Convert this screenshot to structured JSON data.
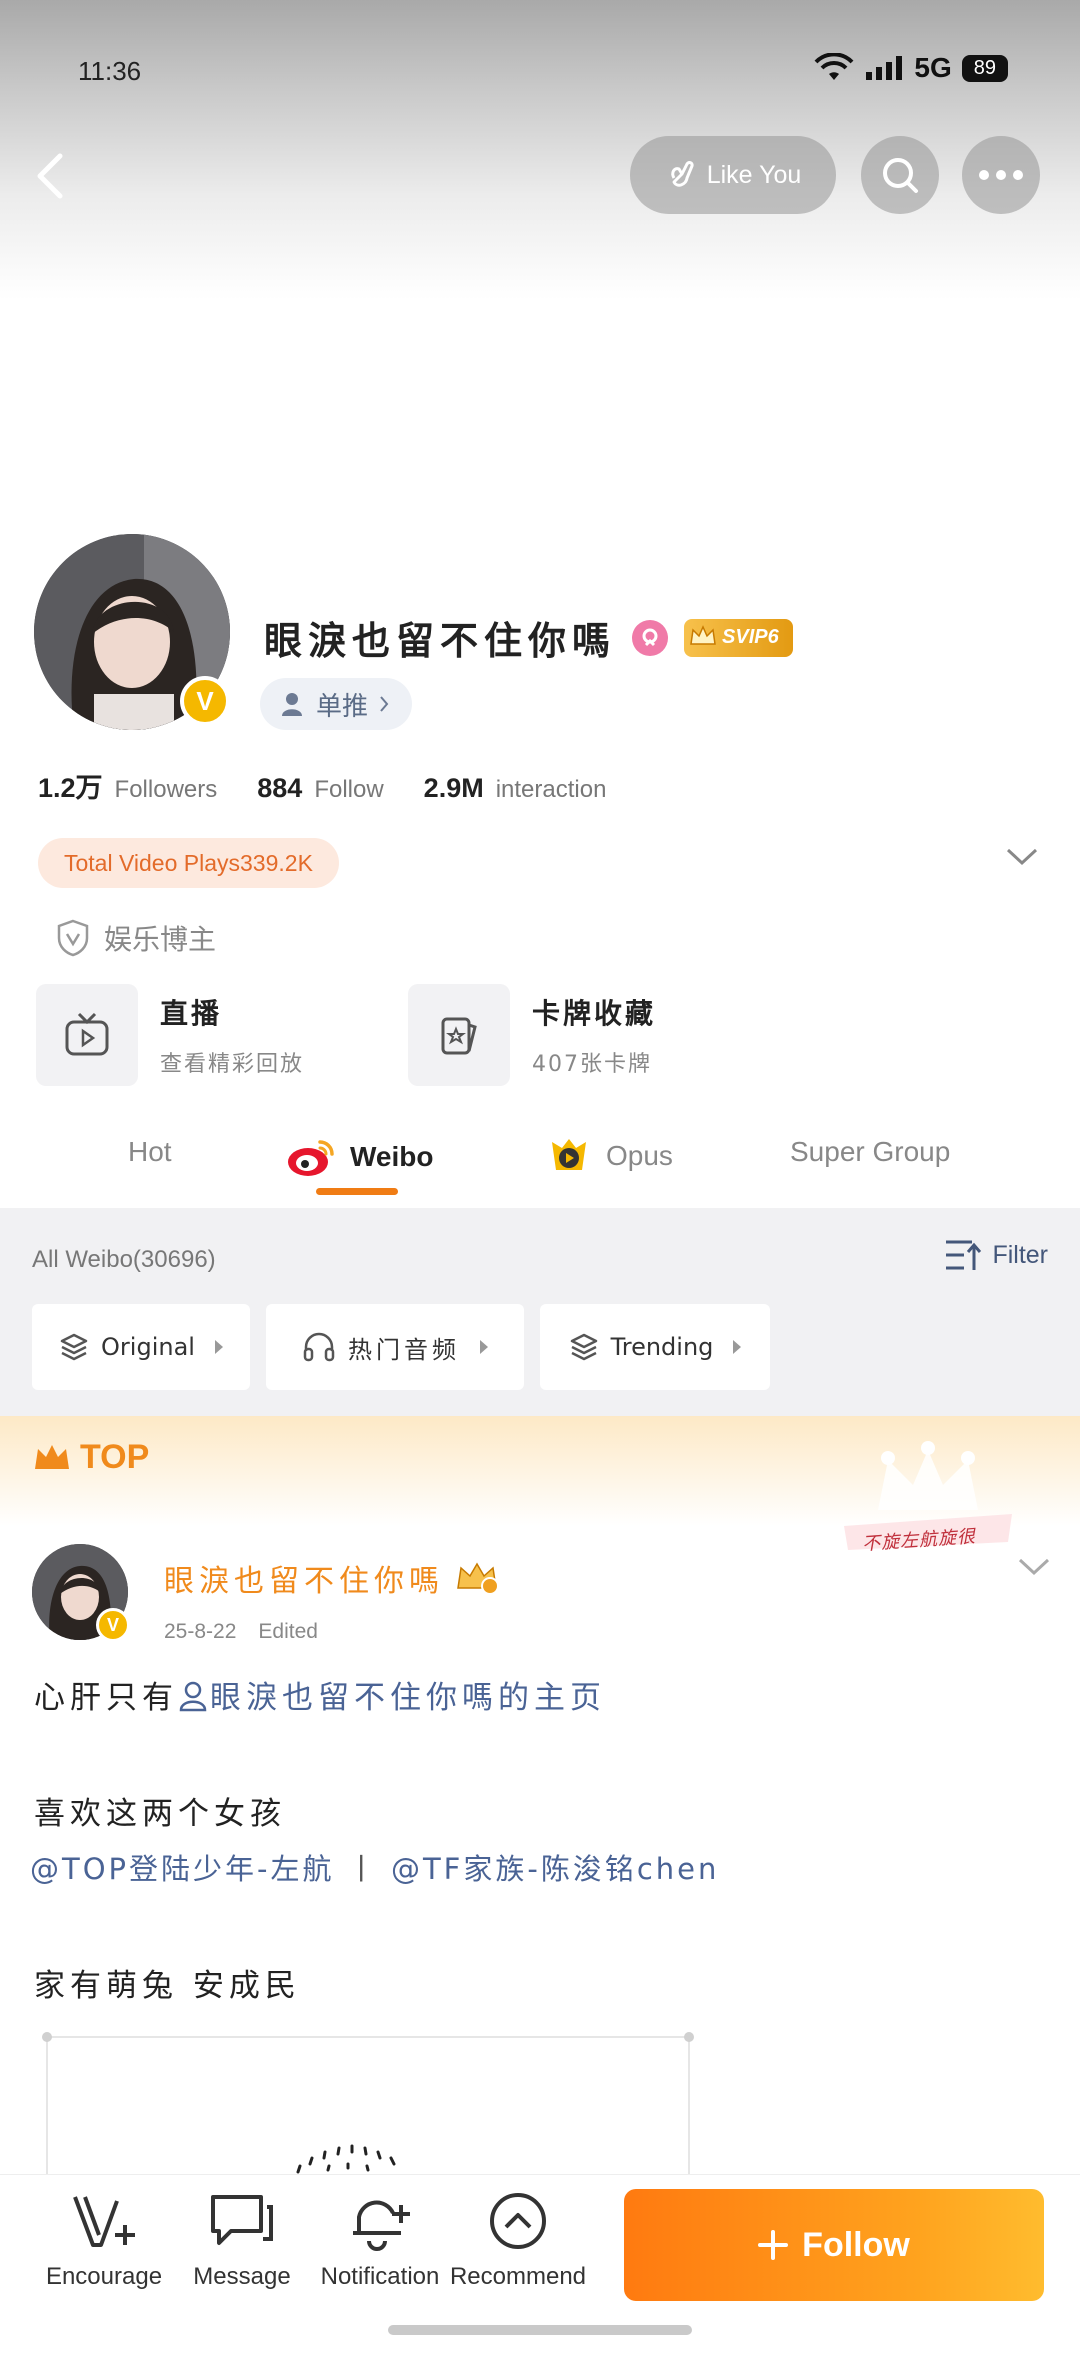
{
  "status_bar": {
    "time": "11:36",
    "network": "5G",
    "battery": "89"
  },
  "topbar": {
    "like_you": "Like You"
  },
  "profile": {
    "name": "眼淚也留不住你嗎",
    "svip": "SVIP6",
    "tag": "单推",
    "stats": [
      {
        "num": "1.2万",
        "label": "Followers"
      },
      {
        "num": "884",
        "label": "Follow"
      },
      {
        "num": "2.9M",
        "label": "interaction"
      }
    ],
    "plays": "Total Video Plays339.2K",
    "certification": "娱乐博主"
  },
  "cards": [
    {
      "title": "直播",
      "subtitle": "查看精彩回放"
    },
    {
      "title": "卡牌收藏",
      "subtitle": "407张卡牌"
    }
  ],
  "tabs": [
    {
      "label": "Hot"
    },
    {
      "label": "Weibo"
    },
    {
      "label": "Opus"
    },
    {
      "label": "Super Group"
    }
  ],
  "filter": {
    "all_weibo": "All  Weibo(30696)",
    "filter_label": "Filter",
    "chips": [
      "Original",
      "热门音频",
      "Trending"
    ]
  },
  "pinned": {
    "label": "TOP",
    "stamp": "不旋左航旋很"
  },
  "post": {
    "author": "眼淚也留不住你嗎",
    "date": "25-8-22",
    "edited": "Edited",
    "line1_prefix": "心肝只有",
    "line1_link": "眼淚也留不住你嗎的主页",
    "line2": "喜欢这两个女孩",
    "line3_link1": "@TOP登陆少年-左航",
    "line3_sep": "丨",
    "line3_link2": "@TF家族-陈浚铭chen",
    "line4": "家有萌兔 安成民"
  },
  "bottom_bar": {
    "encourage": "Encourage",
    "message": "Message",
    "notification": "Notification",
    "recommend": "Recommend",
    "follow": "Follow"
  },
  "colors": {
    "accent": "#f08a1c",
    "link": "#4a6395",
    "follow_start": "#ff7a10",
    "follow_end": "#ffbc2e"
  }
}
